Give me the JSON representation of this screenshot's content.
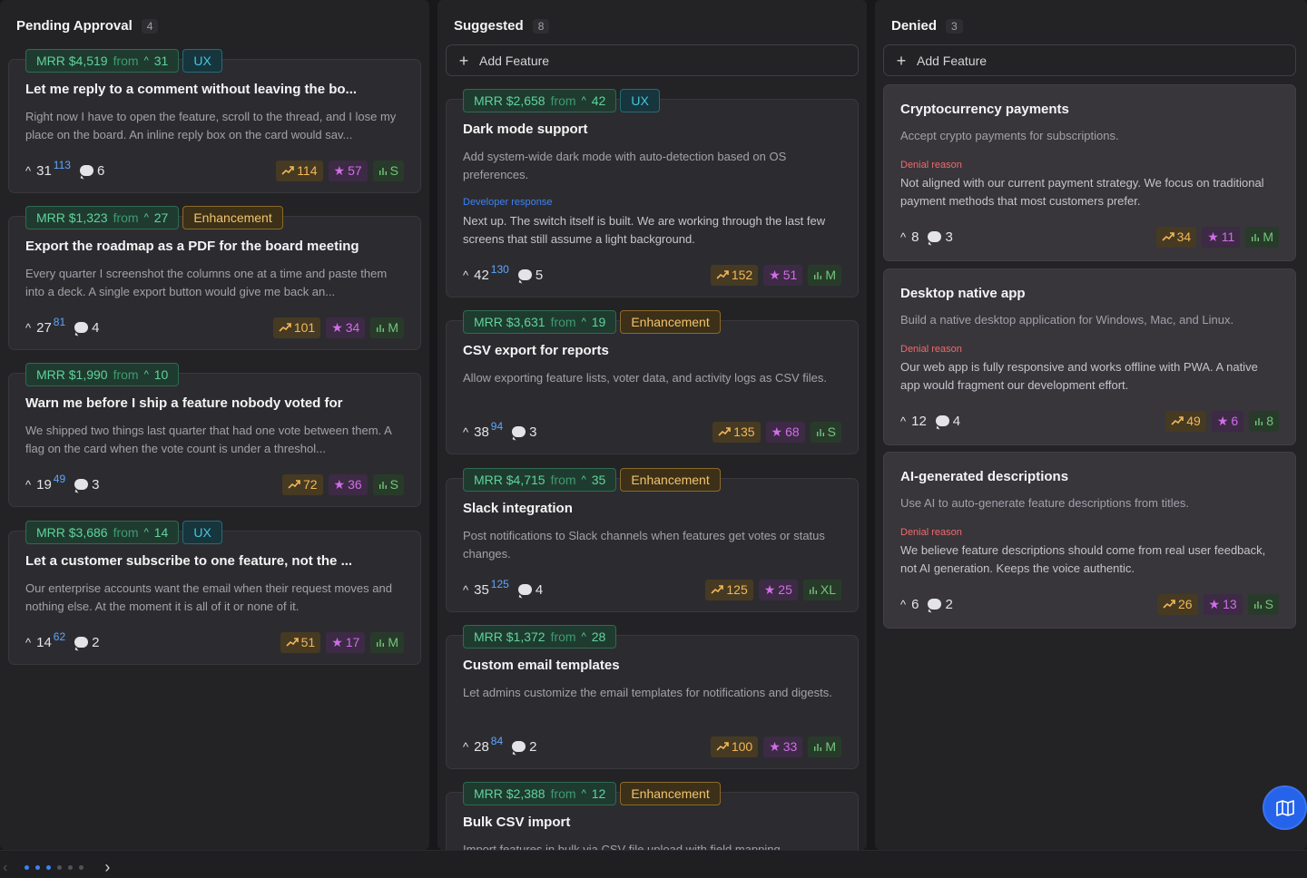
{
  "columns": {
    "pending": {
      "title": "Pending Approval",
      "count": "4",
      "cards": [
        {
          "mrr": "MRR $4,519",
          "mrr_from": "from",
          "mrr_count": "31",
          "tag": "UX",
          "title": "Let me reply to a comment without leaving the bo...",
          "desc": "Right now I have to open the feature, scroll to the thread, and I lose my place on the board. An inline reply box on the card would sav...",
          "votes": "31",
          "votes_sup": "113",
          "comments": "6",
          "trend": "114",
          "stars": "57",
          "size": "S"
        },
        {
          "mrr": "MRR $1,323",
          "mrr_from": "from",
          "mrr_count": "27",
          "tag": "Enhancement",
          "title": "Export the roadmap as a PDF for the board meeting",
          "desc": "Every quarter I screenshot the columns one at a time and paste them into a deck. A single export button would give me back an...",
          "votes": "27",
          "votes_sup": "81",
          "comments": "4",
          "trend": "101",
          "stars": "34",
          "size": "M"
        },
        {
          "mrr": "MRR $1,990",
          "mrr_from": "from",
          "mrr_count": "10",
          "tag": "",
          "title": "Warn me before I ship a feature nobody voted for",
          "desc": "We shipped two things last quarter that had one vote between them. A flag on the card when the vote count is under a threshol...",
          "votes": "19",
          "votes_sup": "49",
          "comments": "3",
          "trend": "72",
          "stars": "36",
          "size": "S"
        },
        {
          "mrr": "MRR $3,686",
          "mrr_from": "from",
          "mrr_count": "14",
          "tag": "UX",
          "title": "Let a customer subscribe to one feature, not the ...",
          "desc": "Our enterprise accounts want the email when their request moves and nothing else. At the moment it is all of it or none of it.",
          "votes": "14",
          "votes_sup": "62",
          "comments": "2",
          "trend": "51",
          "stars": "17",
          "size": "M"
        }
      ]
    },
    "suggested": {
      "title": "Suggested",
      "count": "8",
      "add_label": "Add Feature",
      "cards": [
        {
          "mrr": "MRR $2,658",
          "mrr_from": "from",
          "mrr_count": "42",
          "tag": "UX",
          "title": "Dark mode support",
          "desc": "Add system-wide dark mode with auto-detection based on OS preferences.",
          "response_label": "Developer response",
          "response": "Next up. The switch itself is built. We are working through the last few screens that still assume a light background.",
          "votes": "42",
          "votes_sup": "130",
          "comments": "5",
          "trend": "152",
          "stars": "51",
          "size": "M"
        },
        {
          "mrr": "MRR $3,631",
          "mrr_from": "from",
          "mrr_count": "19",
          "tag": "Enhancement",
          "title": "CSV export for reports",
          "desc": "Allow exporting feature lists, voter data, and activity logs as CSV files.",
          "votes": "38",
          "votes_sup": "94",
          "comments": "3",
          "trend": "135",
          "stars": "68",
          "size": "S"
        },
        {
          "mrr": "MRR $4,715",
          "mrr_from": "from",
          "mrr_count": "35",
          "tag": "Enhancement",
          "title": "Slack integration",
          "desc": "Post notifications to Slack channels when features get votes or status changes.",
          "votes": "35",
          "votes_sup": "125",
          "comments": "4",
          "trend": "125",
          "stars": "25",
          "size": "XL"
        },
        {
          "mrr": "MRR $1,372",
          "mrr_from": "from",
          "mrr_count": "28",
          "tag": "",
          "title": "Custom email templates",
          "desc": "Let admins customize the email templates for notifications and digests.",
          "votes": "28",
          "votes_sup": "84",
          "comments": "2",
          "trend": "100",
          "stars": "33",
          "size": "M"
        },
        {
          "mrr": "MRR $2,388",
          "mrr_from": "from",
          "mrr_count": "12",
          "tag": "Enhancement",
          "title": "Bulk CSV import",
          "desc": "Import features in bulk via CSV file upload with field mapping."
        }
      ]
    },
    "denied": {
      "title": "Denied",
      "count": "3",
      "add_label": "Add Feature",
      "cards": [
        {
          "title": "Cryptocurrency payments",
          "desc": "Accept crypto payments for subscriptions.",
          "reason_label": "Denial reason",
          "reason": "Not aligned with our current payment strategy. We focus on traditional payment methods that most customers prefer.",
          "votes": "8",
          "comments": "3",
          "trend": "34",
          "stars": "11",
          "size": "M"
        },
        {
          "title": "Desktop native app",
          "desc": "Build a native desktop application for Windows, Mac, and Linux.",
          "reason_label": "Denial reason",
          "reason": "Our web app is fully responsive and works offline with PWA. A native app would fragment our development effort.",
          "votes": "12",
          "comments": "4",
          "trend": "49",
          "stars": "6",
          "size": "8"
        },
        {
          "title": "AI-generated descriptions",
          "desc": "Use AI to auto-generate feature descriptions from titles.",
          "reason_label": "Denial reason",
          "reason": "We believe feature descriptions should come from real user feedback, not AI generation. Keeps the voice authentic.",
          "votes": "6",
          "comments": "2",
          "trend": "26",
          "stars": "13",
          "size": "S"
        }
      ]
    }
  },
  "icons": {
    "plus": "+",
    "caret_up": "^",
    "chevron_left": "‹",
    "chevron_right": "›"
  },
  "colors": {
    "accent": "#2563eb",
    "mrr": "#5fd39a",
    "ux": "#43c7de",
    "enhancement": "#f2c46c",
    "trend": "#f2b75a",
    "star": "#d16ee8",
    "size": "#73c67c",
    "denial": "#ef6b6b",
    "developer_response": "#3b82f6"
  }
}
